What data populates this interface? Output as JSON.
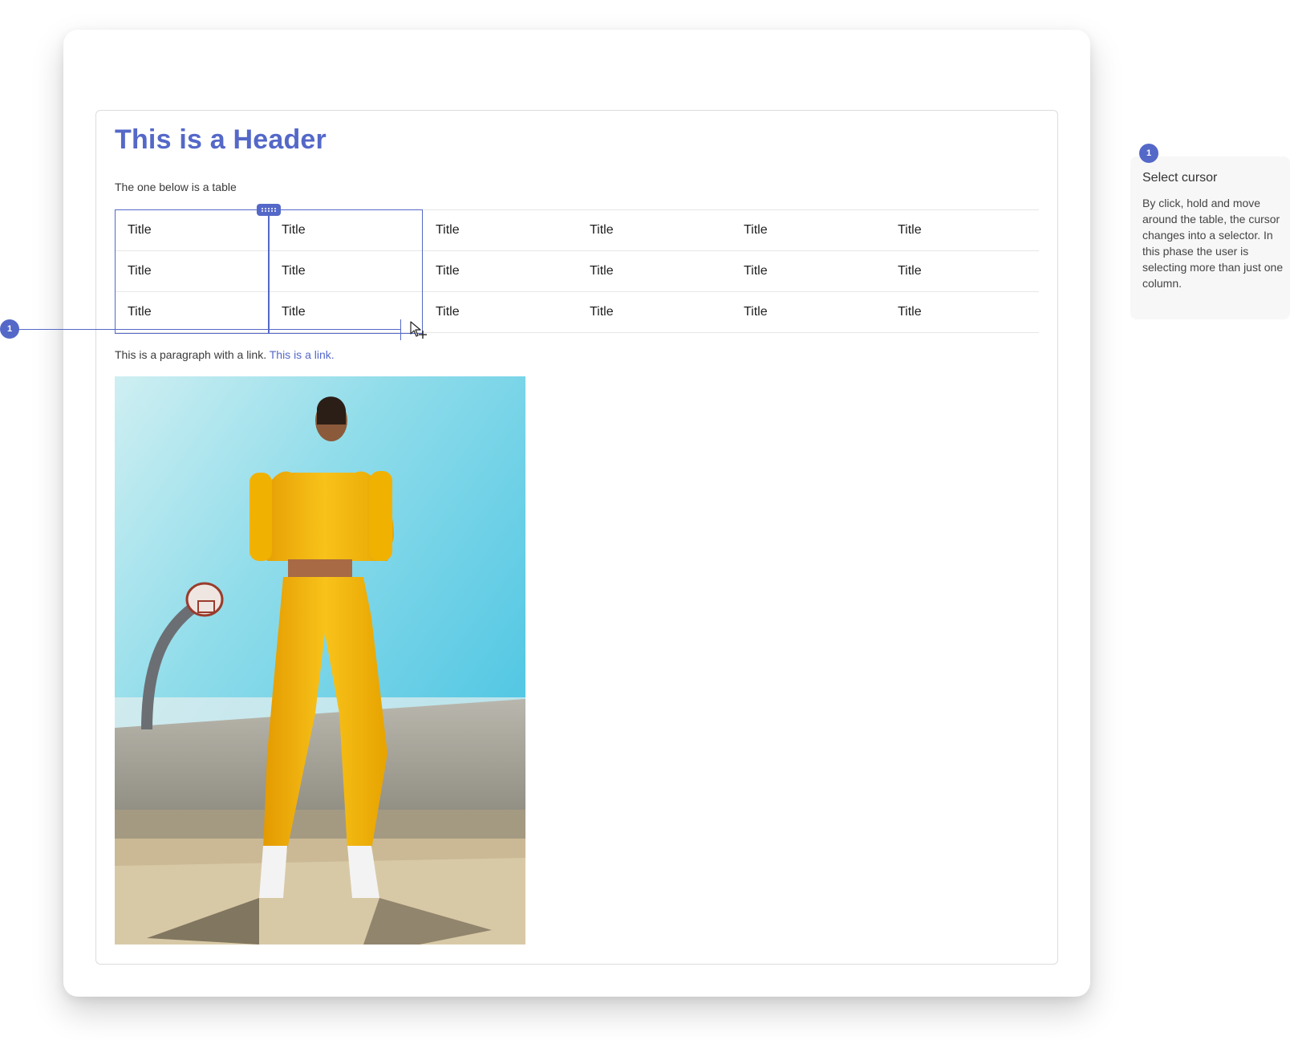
{
  "document": {
    "header": "This is a Header",
    "intro": "The one below is a table",
    "table": {
      "rows": [
        [
          "Title",
          "Title",
          "Title",
          "Title",
          "Title",
          "Title"
        ],
        [
          "Title",
          "Title",
          "Title",
          "Title",
          "Title",
          "Title"
        ],
        [
          "Title",
          "Title",
          "Title",
          "Title",
          "Title",
          "Title"
        ]
      ],
      "selected_columns": [
        1,
        2
      ]
    },
    "paragraph": {
      "text": "This is a paragraph with a link. ",
      "link": "This is a link."
    },
    "image": {
      "icon": "photo-woman-yellow-tracksuit-basketball-court"
    }
  },
  "annotation": {
    "number": "1",
    "title": "Select cursor",
    "body": "By click, hold and move around the table, the cursor changes into a selector. In this phase the user is selecting more than just one column."
  },
  "colors": {
    "accent": "#5468c8",
    "text": "#333333",
    "note_bg": "#f7f7f7"
  }
}
